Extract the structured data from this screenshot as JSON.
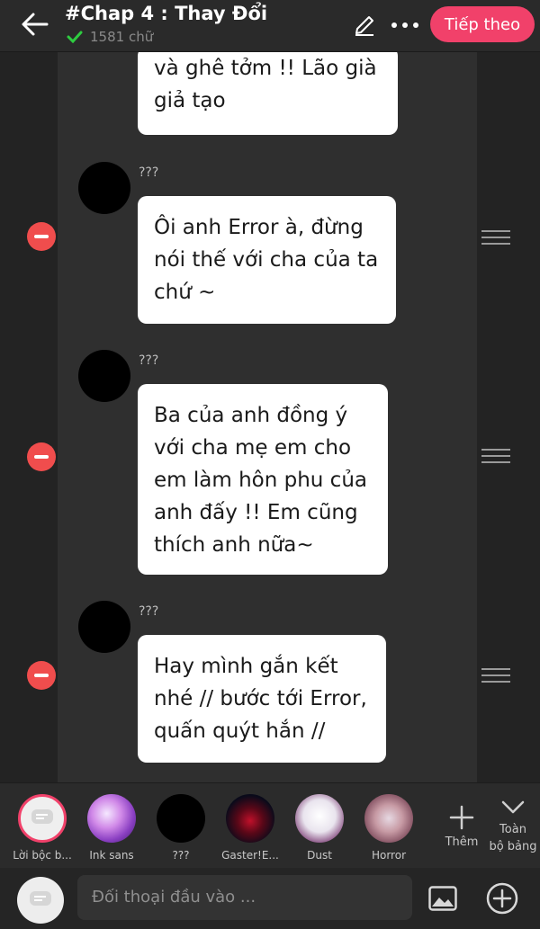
{
  "header": {
    "title": "#Chap 4 : Thay Đổi",
    "word_count": "1581 chữ",
    "next_label": "Tiếp theo"
  },
  "messages": [
    {
      "speaker": "",
      "text": "và ghê tởm !! Lão già\ngiả tạo"
    },
    {
      "speaker": "???",
      "text": "Ôi anh Error à, đừng\nnói thế với cha của ta\nchứ ~"
    },
    {
      "speaker": "???",
      "text": "Ba của anh đồng ý\nvới cha mẹ em cho\nem làm hôn phu của\nanh đấy !! Em cũng\nthích anh nữa~"
    },
    {
      "speaker": "???",
      "text": "Hay mình gắn kết\nnhé // bước tới Error,\nquấn quýt hắn //"
    }
  ],
  "characters": [
    {
      "name": "Lời bộc b...",
      "icon": "speech-bubble-icon"
    },
    {
      "name": "Ink sans"
    },
    {
      "name": "???"
    },
    {
      "name": "Gaster!E..."
    },
    {
      "name": "Dust"
    },
    {
      "name": "Horror"
    }
  ],
  "more_label": "Thêm",
  "all_label": "Toàn\nbộ bảng",
  "input": {
    "placeholder": "Đối thoại đầu vào ..."
  },
  "colors": {
    "accent": "#f1416a",
    "remove": "#f04d4d",
    "check": "#2ecc40"
  }
}
